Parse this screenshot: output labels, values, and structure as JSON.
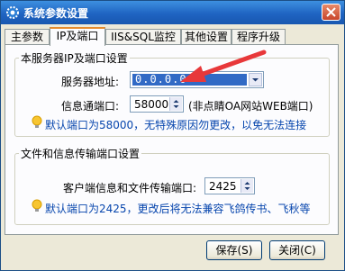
{
  "window": {
    "title": "系统参数设置"
  },
  "tabs": [
    {
      "label": "主参数"
    },
    {
      "label": "IP及端口"
    },
    {
      "label": "IIS&SQL监控"
    },
    {
      "label": "其他设置"
    },
    {
      "label": "程序升级"
    }
  ],
  "server_group": {
    "legend": "本服务器IP及端口设置",
    "address_label": "服务器地址:",
    "address_value": "0.0.0.0",
    "port_label": "信息通端口:",
    "port_value": "58000",
    "port_note": "(非点睛OA网站WEB端口)",
    "tip": "默认端口为58000，无特殊原因勿更改，以免无法连接"
  },
  "transfer_group": {
    "legend": "文件和信息传输端口设置",
    "port_label": "客户端信息和文件传输端口:",
    "port_value": "2425",
    "tip": "默认端口为2425，更改后将无法兼容飞鸽传书、飞秋等"
  },
  "buttons": {
    "save": "保存(S)",
    "close": "关闭(C)"
  },
  "colors": {
    "titlebar": "#1f64c2",
    "selection": "#316ac5",
    "tip_text": "#0645ad",
    "annotation_arrow": "#e8383a",
    "tab_highlight": "#e68b2c"
  },
  "icons": {
    "app": "gear-icon",
    "tip": "lightbulb-icon",
    "close": "close-icon",
    "dropdown": "chevron-down-icon"
  }
}
